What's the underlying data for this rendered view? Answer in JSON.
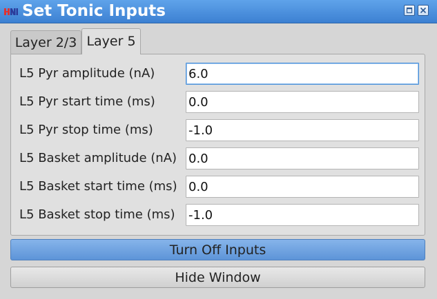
{
  "window": {
    "title": "Set Tonic Inputs",
    "app_icon": "hnn-logo-icon",
    "controls": [
      "maximize-icon",
      "close-icon"
    ]
  },
  "tabs": [
    {
      "label": "Layer 2/3",
      "selected": false
    },
    {
      "label": "Layer 5",
      "selected": true
    }
  ],
  "fields": [
    {
      "label": "L5 Pyr amplitude (nA)",
      "value": "6.0"
    },
    {
      "label": "L5 Pyr start time (ms)",
      "value": "0.0"
    },
    {
      "label": "L5 Pyr stop time (ms)",
      "value": "-1.0"
    },
    {
      "label": "L5 Basket amplitude (nA)",
      "value": "0.0"
    },
    {
      "label": "L5 Basket start time (ms)",
      "value": "0.0"
    },
    {
      "label": "L5 Basket stop time (ms)",
      "value": "-1.0"
    }
  ],
  "buttons": {
    "turn_off": "Turn Off Inputs",
    "hide": "Hide Window"
  },
  "colors": {
    "titlebar": "#3c80d2",
    "primary_button": "#6b9fe0",
    "focus_border": "#4a90d9"
  }
}
